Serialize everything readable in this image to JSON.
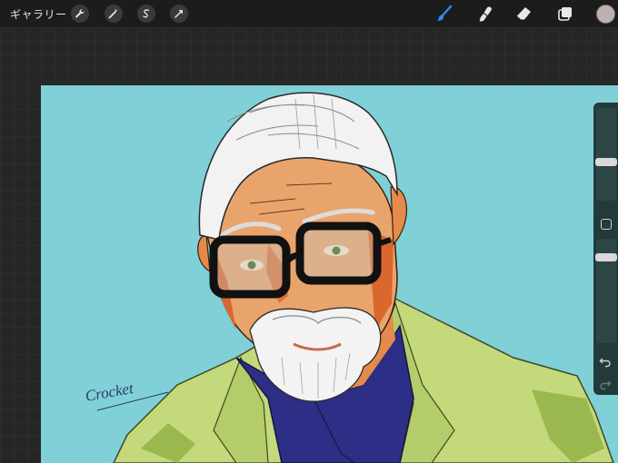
{
  "toolbar": {
    "gallery_label": "ギャラリー",
    "left_tools": [
      "wrench-icon",
      "magic-wand-icon",
      "selection-icon",
      "transform-arrow-icon"
    ],
    "right_tools": [
      "brush-icon",
      "smudge-icon",
      "eraser-icon",
      "layers-icon"
    ],
    "active_tool": "brush-icon",
    "active_color": "#bdb1ad",
    "accent": "#2f8cff"
  },
  "canvas": {
    "background": "#80d0d8",
    "signature": "Crocket"
  },
  "sidebar": {
    "size_slider_value": 0.15,
    "opacity_slider_value": 0.85
  }
}
